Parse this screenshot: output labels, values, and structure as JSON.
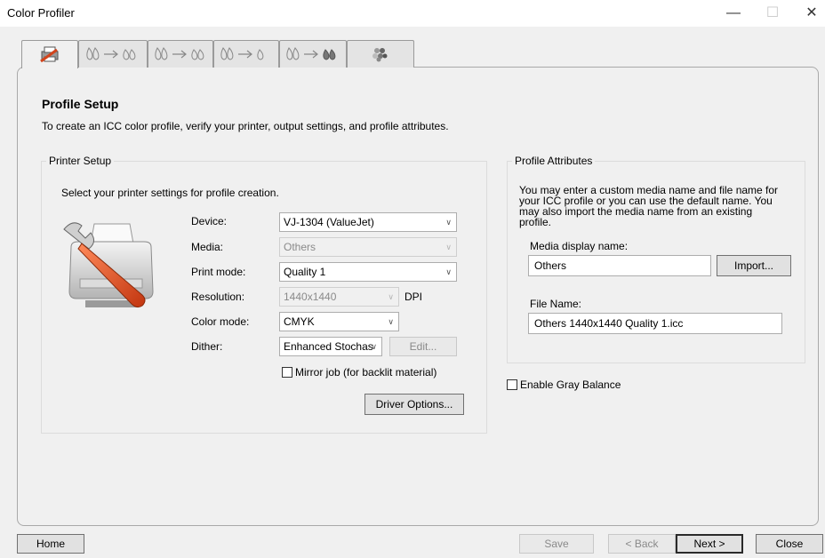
{
  "window": {
    "title": "Color Profiler"
  },
  "tabs": [
    {
      "icon": "printer-icon"
    },
    {
      "icon": "ink-to-ink-icon"
    },
    {
      "icon": "ink-to-ink-icon"
    },
    {
      "icon": "ink-to-ink-icon"
    },
    {
      "icon": "ink-to-ink-icon"
    },
    {
      "icon": "color-patches-icon"
    }
  ],
  "page": {
    "title": "Profile Setup",
    "subtitle": "To create an ICC color profile, verify your printer, output settings, and profile attributes."
  },
  "printer_setup": {
    "group_title": "Printer Setup",
    "instruction": "Select your printer settings for profile creation.",
    "device_label": "Device:",
    "device_value": "VJ-1304 (ValueJet)",
    "media_label": "Media:",
    "media_value": "Others",
    "print_mode_label": "Print mode:",
    "print_mode_value": "Quality 1",
    "resolution_label": "Resolution:",
    "resolution_value": "1440x1440",
    "resolution_unit": "DPI",
    "color_mode_label": "Color mode:",
    "color_mode_value": "CMYK",
    "dither_label": "Dither:",
    "dither_value": "Enhanced Stochas",
    "edit_label": "Edit...",
    "mirror_label": "Mirror job (for backlit material)",
    "driver_options_label": "Driver Options..."
  },
  "profile_attributes": {
    "group_title": "Profile Attributes",
    "description": "You may enter a custom media name and file name for your ICC profile or you can use the default name. You may also import the media name from an existing profile.",
    "media_name_label": "Media display name:",
    "media_name_value": "Others",
    "import_label": "Import...",
    "file_name_label": "File Name:",
    "file_name_value": "Others 1440x1440 Quality 1.icc"
  },
  "gray_balance_label": "Enable Gray Balance",
  "footer": {
    "home": "Home",
    "save": "Save",
    "back": "< Back",
    "next": "Next >",
    "close": "Close"
  },
  "colors": {
    "accent_orange": "#d2441c",
    "window_bg": "#f0f0f0"
  }
}
